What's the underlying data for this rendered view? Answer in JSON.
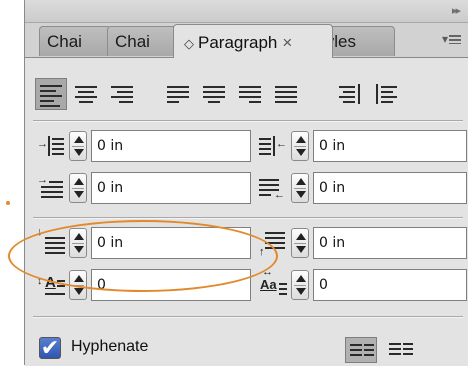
{
  "panel": {
    "tabs": [
      {
        "label": "Chai",
        "active": false
      },
      {
        "label": "Chai",
        "active": false
      },
      {
        "label": "Paragraph",
        "active": true
      },
      {
        "label": "tyles",
        "active": false
      }
    ],
    "active_tab_prefix_icon": "diamond-icon",
    "close_glyph": "×"
  },
  "alignment": {
    "buttons": [
      {
        "name": "align-left",
        "selected": true
      },
      {
        "name": "align-center",
        "selected": false
      },
      {
        "name": "align-right",
        "selected": false
      },
      {
        "name": "justify-left",
        "selected": false
      },
      {
        "name": "justify-center",
        "selected": false
      },
      {
        "name": "justify-right",
        "selected": false
      },
      {
        "name": "justify-all",
        "selected": false
      },
      {
        "name": "align-toward-spine",
        "selected": false
      },
      {
        "name": "align-away-from-spine",
        "selected": false
      }
    ]
  },
  "fields": {
    "left_indent": "0 in",
    "right_indent": "0 in",
    "first_line_indent": "0 in",
    "last_line_right_indent": "0 in",
    "space_before": "0 in",
    "space_after": "0 in",
    "drop_cap_lines": "0",
    "drop_cap_chars": "0"
  },
  "drop_cap_icon_text": {
    "left": "A",
    "right": "Aa"
  },
  "hyphenate": {
    "label": "Hyphenate",
    "checked": true,
    "check_glyph": "✔"
  },
  "colors": {
    "annotation": "#e08a2c",
    "checkbox": "#2f56b0"
  }
}
